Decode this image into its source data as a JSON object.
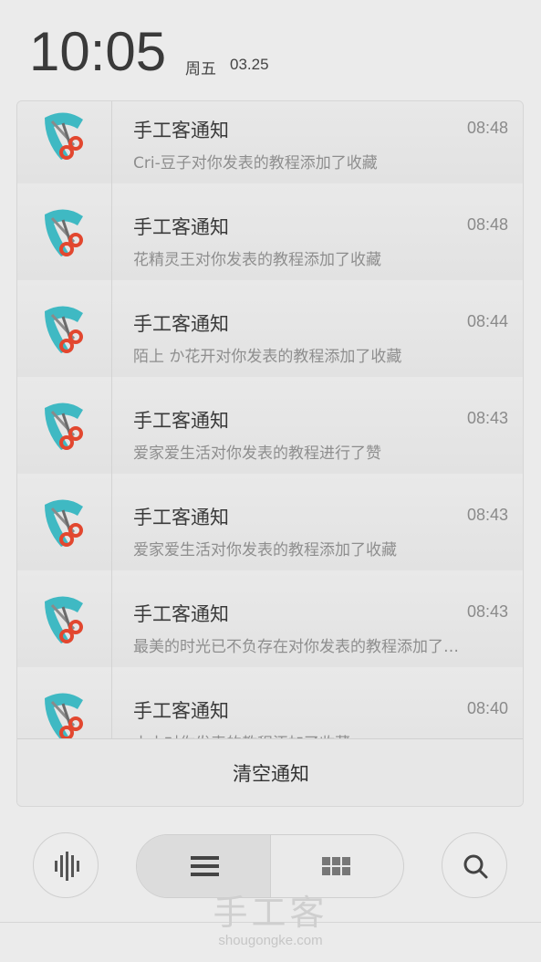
{
  "status": {
    "time": "10:05",
    "weekday": "周五",
    "date": "03.25"
  },
  "notifications": [
    {
      "title": "手工客通知",
      "time": "08:48",
      "body": "Cri-豆子对你发表的教程添加了收藏",
      "icon": "shougongke-scissors-icon"
    },
    {
      "title": "手工客通知",
      "time": "08:48",
      "body": "花精灵王对你发表的教程添加了收藏",
      "icon": "shougongke-scissors-icon"
    },
    {
      "title": "手工客通知",
      "time": "08:44",
      "body": "陌上 か花开对你发表的教程添加了收藏",
      "icon": "shougongke-scissors-icon"
    },
    {
      "title": "手工客通知",
      "time": "08:43",
      "body": "爱家爱生活对你发表的教程进行了赞",
      "icon": "shougongke-scissors-icon"
    },
    {
      "title": "手工客通知",
      "time": "08:43",
      "body": "爱家爱生活对你发表的教程添加了收藏",
      "icon": "shougongke-scissors-icon"
    },
    {
      "title": "手工客通知",
      "time": "08:43",
      "body": "最美的时光已不负存在对你发表的教程添加了…",
      "icon": "shougongke-scissors-icon"
    },
    {
      "title": "手工客通知",
      "time": "08:40",
      "body": "小小对你发表的教程添加了收藏",
      "icon": "shougongke-scissors-icon"
    }
  ],
  "clear_label": "清空通知",
  "toolbar": {
    "left_icon": "voice-bars-icon",
    "list_icon": "list-icon",
    "grid_icon": "grid-icon",
    "right_icon": "search-icon"
  },
  "watermark": {
    "logo": "手工客",
    "url": "shougongke.com"
  },
  "colors": {
    "teal": "#3fb9c3",
    "scissors_red": "#e2472f",
    "panel_bg": "#e4e4e4"
  }
}
